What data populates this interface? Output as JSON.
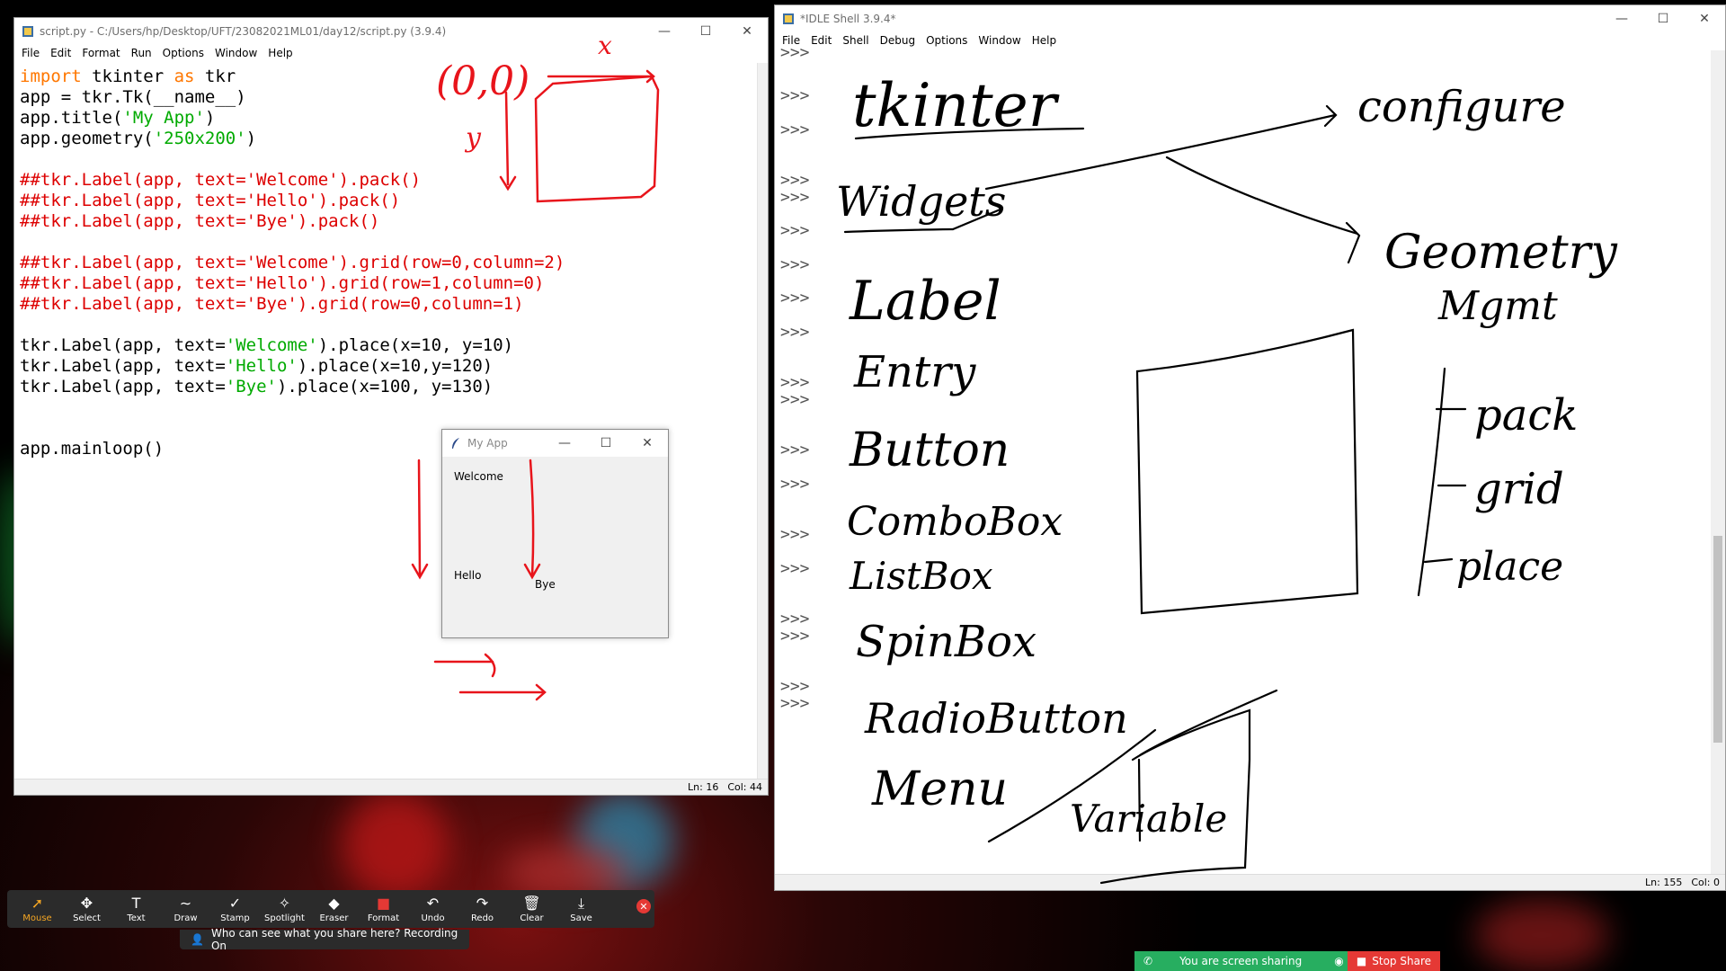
{
  "editor": {
    "title": "script.py - C:/Users/hp/Desktop/UFT/23082021ML01/day12/script.py (3.9.4)",
    "menu": [
      "File",
      "Edit",
      "Format",
      "Run",
      "Options",
      "Window",
      "Help"
    ],
    "status_line": "Ln: 16",
    "status_col": "Col: 44",
    "code": [
      [
        {
          "t": "import",
          "c": "kw"
        },
        {
          "t": " tkinter ",
          "c": "blk"
        },
        {
          "t": "as",
          "c": "kw"
        },
        {
          "t": " tkr",
          "c": "blk"
        }
      ],
      [
        {
          "t": "app = tkr.Tk(__name__)",
          "c": "blk"
        }
      ],
      [
        {
          "t": "app.title(",
          "c": "blk"
        },
        {
          "t": "'My App'",
          "c": "str"
        },
        {
          "t": ")",
          "c": "blk"
        }
      ],
      [
        {
          "t": "app.geometry(",
          "c": "blk"
        },
        {
          "t": "'250x200'",
          "c": "str"
        },
        {
          "t": ")",
          "c": "blk"
        }
      ],
      [
        {
          "t": "",
          "c": "blk"
        }
      ],
      [
        {
          "t": "##tkr.Label(app, text='Welcome').pack()",
          "c": "cmt"
        }
      ],
      [
        {
          "t": "##tkr.Label(app, text='Hello').pack()",
          "c": "cmt"
        }
      ],
      [
        {
          "t": "##tkr.Label(app, text='Bye').pack()",
          "c": "cmt"
        }
      ],
      [
        {
          "t": "",
          "c": "blk"
        }
      ],
      [
        {
          "t": "##tkr.Label(app, text='Welcome').grid(row=0,column=2)",
          "c": "cmt"
        }
      ],
      [
        {
          "t": "##tkr.Label(app, text='Hello').grid(row=1,column=0)",
          "c": "cmt"
        }
      ],
      [
        {
          "t": "##tkr.Label(app, text='Bye').grid(row=0,column=1)",
          "c": "cmt"
        }
      ],
      [
        {
          "t": "",
          "c": "blk"
        }
      ],
      [
        {
          "t": "tkr.Label(app, text=",
          "c": "blk"
        },
        {
          "t": "'Welcome'",
          "c": "str"
        },
        {
          "t": ").place(x=10, y=10)",
          "c": "blk"
        }
      ],
      [
        {
          "t": "tkr.Label(app, text=",
          "c": "blk"
        },
        {
          "t": "'Hello'",
          "c": "str"
        },
        {
          "t": ").place(x=10,y=120)",
          "c": "blk"
        }
      ],
      [
        {
          "t": "tkr.Label(app, text=",
          "c": "blk"
        },
        {
          "t": "'Bye'",
          "c": "str"
        },
        {
          "t": ").place(x=100, y=130)",
          "c": "blk"
        }
      ],
      [
        {
          "t": "",
          "c": "blk"
        }
      ],
      [
        {
          "t": "",
          "c": "blk"
        }
      ],
      [
        {
          "t": "app.mainloop()",
          "c": "blk"
        }
      ]
    ]
  },
  "myapp": {
    "title": "My App",
    "labels": {
      "welcome": "Welcome",
      "hello": "Hello",
      "bye": "Bye"
    }
  },
  "shell": {
    "title": "*IDLE Shell 3.9.4*",
    "menu": [
      "File",
      "Edit",
      "Shell",
      "Debug",
      "Options",
      "Window",
      "Help"
    ],
    "prompt": ">>>",
    "status_line": "Ln: 155",
    "status_col": "Col: 0"
  },
  "annotations": {
    "origin": "(0,0)",
    "x_axis": "x",
    "y_axis": "y",
    "tkinter": "tkinter",
    "widgets": "Widgets",
    "configure": "configure",
    "geometry": "Geometry",
    "mgmt": "Mgmt",
    "widget_list": [
      "Label",
      "Entry",
      "Button",
      "ComboBox",
      "ListBox",
      "SpinBox",
      "RadioButton",
      "Menu"
    ],
    "variable": "Variable",
    "geometry_methods": [
      "pack",
      "grid",
      "place"
    ]
  },
  "zoom_toolbar": {
    "tools": [
      {
        "label": "Mouse",
        "icon": "pointer-icon",
        "glyph": "➚"
      },
      {
        "label": "Select",
        "icon": "move-icon",
        "glyph": "✥"
      },
      {
        "label": "Text",
        "icon": "text-icon",
        "glyph": "T"
      },
      {
        "label": "Draw",
        "icon": "draw-icon",
        "glyph": "∼"
      },
      {
        "label": "Stamp",
        "icon": "stamp-icon",
        "glyph": "✓"
      },
      {
        "label": "Spotlight",
        "icon": "spotlight-icon",
        "glyph": "✧"
      },
      {
        "label": "Eraser",
        "icon": "eraser-icon",
        "glyph": "◆"
      },
      {
        "label": "Format",
        "icon": "format-icon",
        "glyph": "■"
      },
      {
        "label": "Undo",
        "icon": "undo-icon",
        "glyph": "↶"
      },
      {
        "label": "Redo",
        "icon": "redo-icon",
        "glyph": "↷"
      },
      {
        "label": "Clear",
        "icon": "trash-icon",
        "glyph": "🗑"
      },
      {
        "label": "Save",
        "icon": "save-icon",
        "glyph": "⤓"
      }
    ],
    "info": "Who can see what you share here? Recording On"
  },
  "share": {
    "status": "You are screen sharing",
    "stop": "Stop Share"
  },
  "colors": {
    "ink_red": "#e8141b",
    "ink_black": "#000000",
    "zoom_active": "#f5a623",
    "share_green": "#27ae60",
    "stop_red": "#e53935"
  }
}
